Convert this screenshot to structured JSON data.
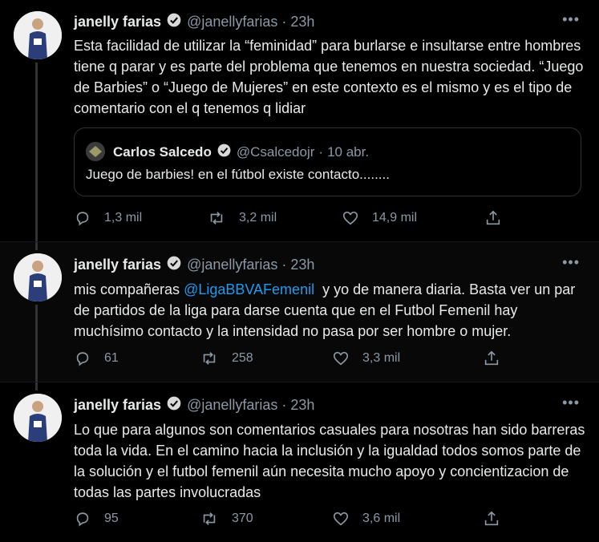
{
  "author": {
    "name": "janelly farias",
    "handle": "@janellyfarias",
    "time": "23h"
  },
  "tweets": [
    {
      "text": "Esta facilidad de utilizar la “feminidad” para burlarse e insultarse entre hombres tiene q parar y es parte del problema que tenemos en nuestra sociedad. “Juego de Barbies” o “Juego de Mujeres” en este contexto es el mismo y es el tipo de comentario con el q tenemos q lidiar",
      "quote": {
        "name": "Carlos Salcedo",
        "handle": "@Csalcedojr",
        "time": "10 abr.",
        "text": "Juego de barbies! en el fútbol existe contacto........"
      },
      "replies": "1,3 mil",
      "retweets": "3,2 mil",
      "likes": "14,9 mil"
    },
    {
      "text_before": "mis compañeras ",
      "mention": "@LigaBBVAFemenil",
      "text_after": "  y yo de manera diaria. Basta ver un par de partidos de la liga para darse cuenta que en el Futbol Femenil hay muchísimo contacto y la intensidad no pasa por ser hombre o mujer.",
      "replies": "61",
      "retweets": "258",
      "likes": "3,3 mil"
    },
    {
      "text": "Lo que para algunos son comentarios casuales para nosotras han sido barreras toda la vida. En el camino hacia la inclusión y la igualdad todos somos parte de la solución y el futbol femenil aún necesita mucho apoyo y concientizacion de todas las partes involucradas",
      "replies": "95",
      "retweets": "370",
      "likes": "3,6 mil"
    }
  ],
  "icons": {
    "verified": "verified-badge-icon",
    "more": "more-icon",
    "reply": "reply-icon",
    "retweet": "retweet-icon",
    "like": "like-icon",
    "share": "share-icon"
  },
  "colors": {
    "background": "#000000",
    "text": "#e7e9ea",
    "secondary": "#8b98a5",
    "accent": "#1d9bf0",
    "border": "#2f3336"
  }
}
